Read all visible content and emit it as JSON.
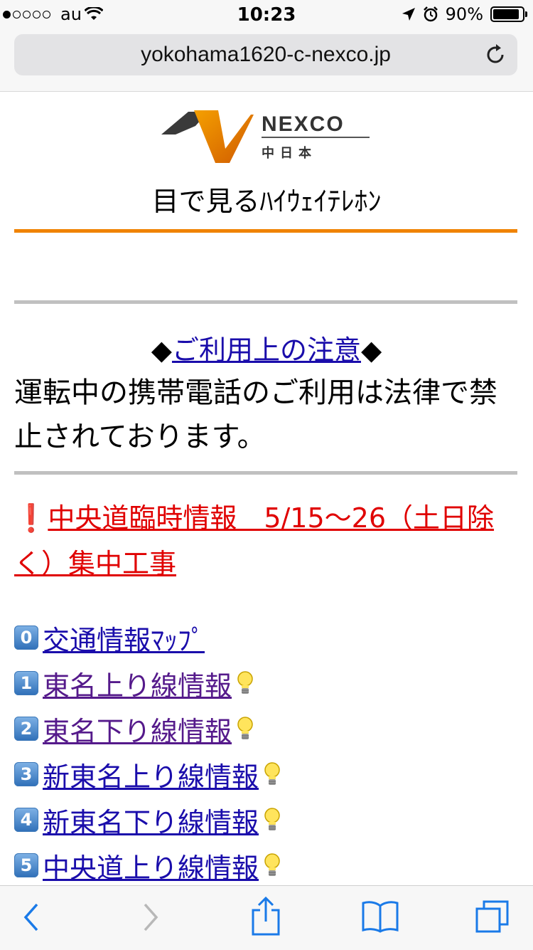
{
  "status": {
    "carrier": "au",
    "time": "10:23",
    "battery": "90%",
    "battery_level": 0.9
  },
  "browser": {
    "url": "yokohama1620-c-nexco.jp"
  },
  "logo": {
    "brand": "NEXCO",
    "region": "中日本"
  },
  "page": {
    "subtitle": "目で見るﾊｲｳｪｲﾃﾚﾎﾝ",
    "notice_link": "ご利用上の注意",
    "notice_diamond": "◆",
    "notice_text": "運転中の携帯電話のご利用は法律で禁止されております。",
    "alert_mark": "❗",
    "alert_text": "中央道臨時情報　5/15〜26（土日除く）集中工事"
  },
  "links": [
    {
      "key": "0",
      "label": "交通情報ﾏｯﾌﾟ",
      "bulb": false,
      "visited": false
    },
    {
      "key": "1",
      "label": "東名上り線情報",
      "bulb": true,
      "visited": true
    },
    {
      "key": "2",
      "label": "東名下り線情報",
      "bulb": true,
      "visited": true
    },
    {
      "key": "3",
      "label": "新東名上り線情報",
      "bulb": true,
      "visited": false
    },
    {
      "key": "4",
      "label": "新東名下り線情報",
      "bulb": true,
      "visited": false
    },
    {
      "key": "5",
      "label": "中央道上り線情報",
      "bulb": true,
      "visited": false
    }
  ],
  "colors": {
    "accent": "#f08300",
    "link": "#1a0dab",
    "visited": "#551a8b",
    "alert": "#e00000"
  }
}
